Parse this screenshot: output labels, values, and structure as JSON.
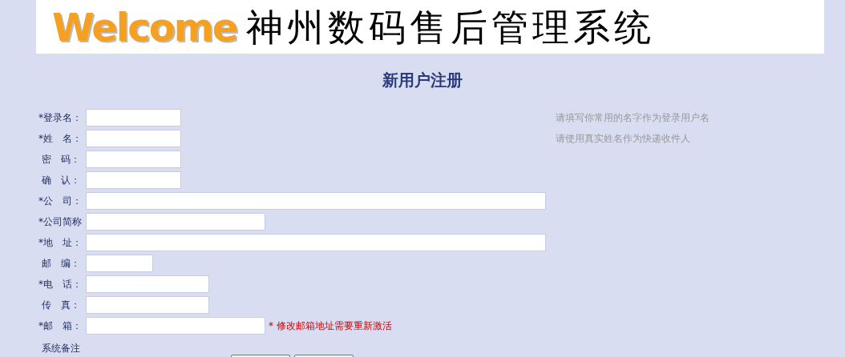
{
  "banner": {
    "welcome": "Welcome",
    "system_name": "神州数码售后管理系统"
  },
  "title": "新用户注册",
  "fields": [
    {
      "label": "*登录名：",
      "hint": "请填写你常用的名字作为登录用户名"
    },
    {
      "label": "*姓　名：",
      "hint": "请使用真实姓名作为快递收件人"
    },
    {
      "label": " 密　码："
    },
    {
      "label": " 确　认："
    },
    {
      "label": "*公　司："
    },
    {
      "label": "*公司简称"
    },
    {
      "label": "*地　址："
    },
    {
      "label": " 邮　编："
    },
    {
      "label": "*电　话："
    },
    {
      "label": " 传　真："
    },
    {
      "label": "*邮　箱：",
      "note": "* 修改邮箱地址需要重新激活"
    }
  ],
  "remarks_label": " 系统备注"
}
